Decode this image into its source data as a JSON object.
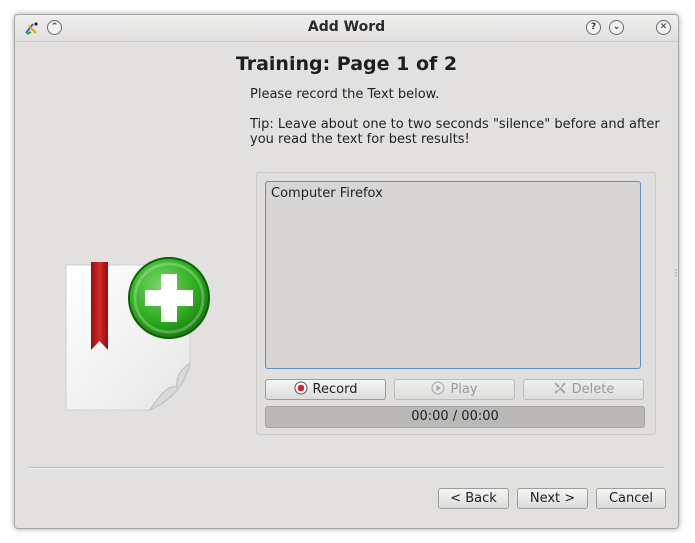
{
  "window": {
    "title": "Add Word",
    "buttons": {
      "shade": "⌃",
      "help": "?",
      "minimize": "⌄",
      "close": "✕"
    }
  },
  "page": {
    "heading": "Training: Page 1 of 2",
    "instruction": "Please record the Text below.",
    "tip": "Tip: Leave about one to two seconds \"silence\" before and after you read the text for best results!"
  },
  "recorder": {
    "text": "Computer Firefox",
    "record_label": "Record",
    "play_label": "Play",
    "delete_label": "Delete",
    "time": "00:00 / 00:00",
    "progress_fraction": 0
  },
  "footer": {
    "back_label": "< Back",
    "next_label": "Next >",
    "cancel_label": "Cancel"
  },
  "colors": {
    "accent_border": "#5b8fcf",
    "record_red": "#d2252a",
    "plus_green": "#2fae1f",
    "bookmark_red": "#c21b1b"
  },
  "icons": [
    "app-logo-icon",
    "shade-icon",
    "help-icon",
    "minimize-icon",
    "close-icon",
    "add-document-icon",
    "record-icon",
    "play-icon",
    "delete-icon"
  ]
}
